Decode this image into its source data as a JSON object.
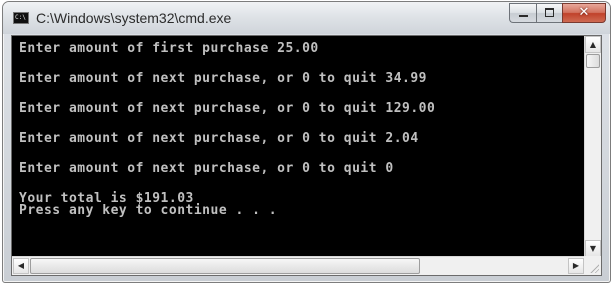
{
  "window": {
    "title": "C:\\Windows\\system32\\cmd.exe",
    "icon": "console-app-icon",
    "icon_text": "C:\\"
  },
  "caption_buttons": {
    "minimize_icon": "minimize-icon",
    "maximize_icon": "maximize-icon",
    "close_icon": "close-icon",
    "close_glyph": "✕"
  },
  "console": {
    "text_color": "#c0c0c0",
    "background": "#000000",
    "lines": [
      "Enter amount of first purchase 25.00",
      "",
      "Enter amount of next purchase, or 0 to quit 34.99",
      "",
      "Enter amount of next purchase, or 0 to quit 129.00",
      "",
      "Enter amount of next purchase, or 0 to quit 2.04",
      "",
      "Enter amount of next purchase, or 0 to quit 0",
      "",
      "Your total is $191.03",
      "Press any key to continue . . ."
    ]
  },
  "scrollbars": {
    "up_arrow": "▲",
    "down_arrow": "▼",
    "left_arrow": "◀",
    "right_arrow": "▶"
  }
}
